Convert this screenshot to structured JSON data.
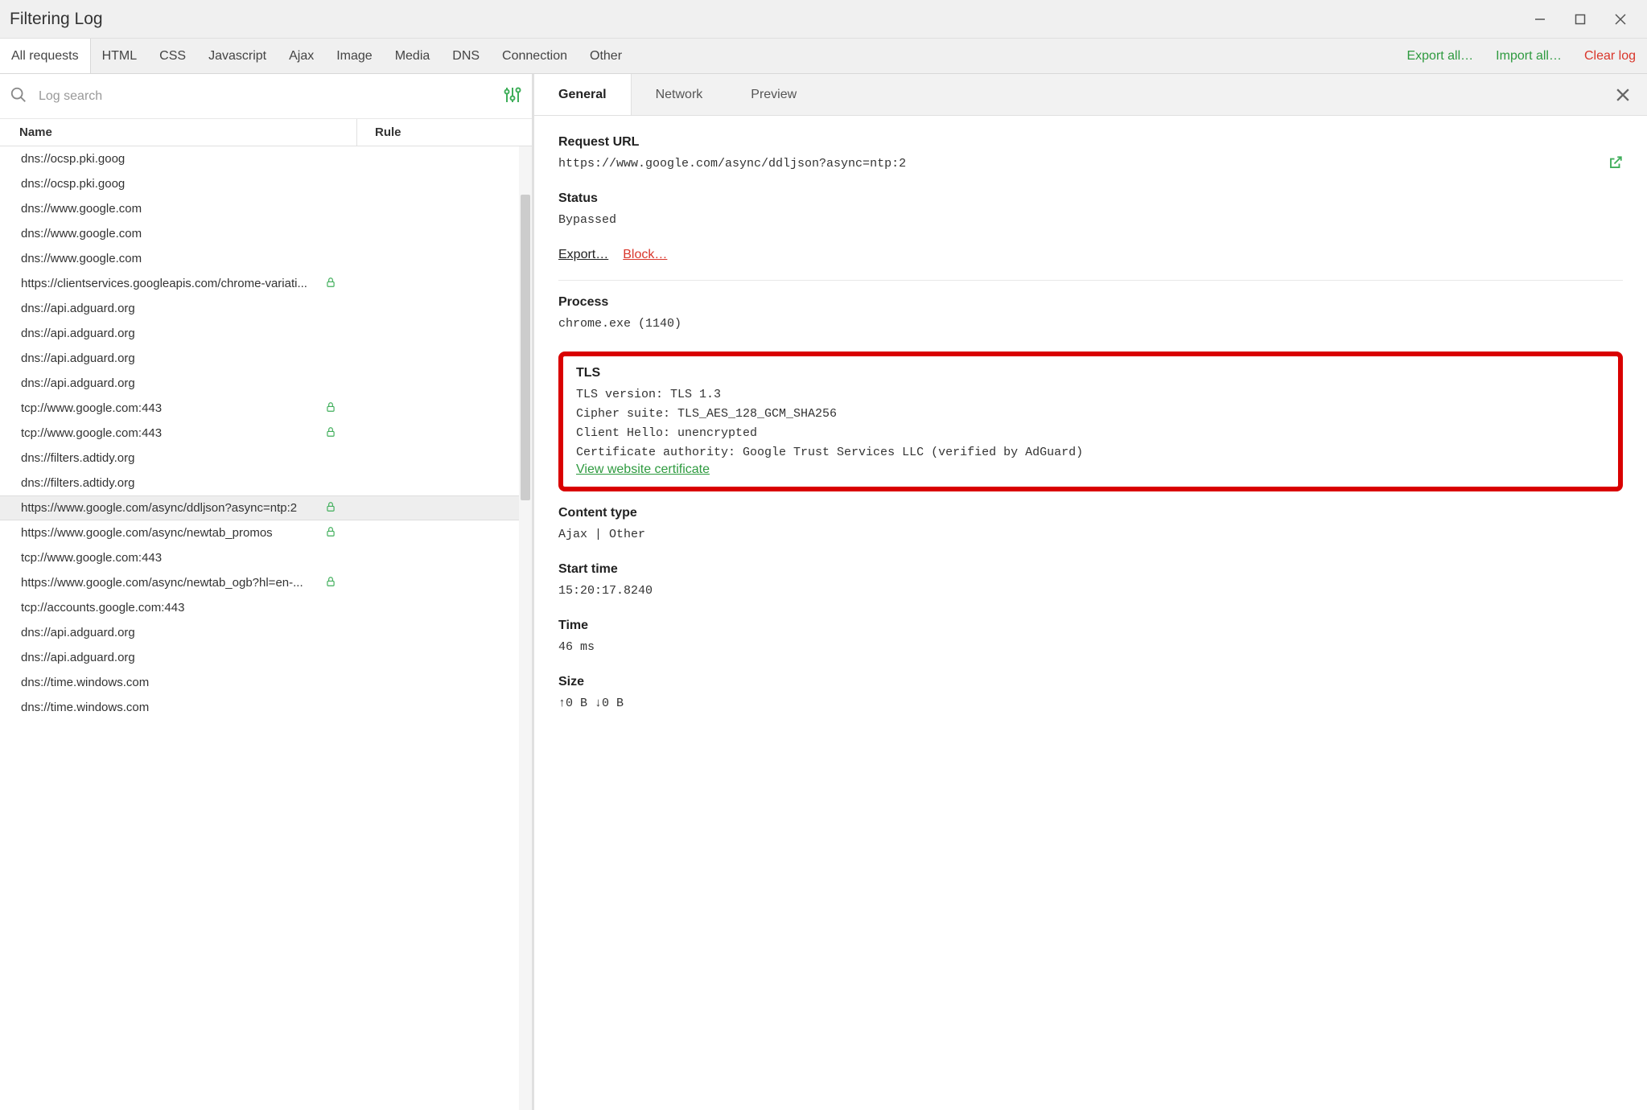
{
  "window": {
    "title": "Filtering Log"
  },
  "filterTabs": [
    {
      "label": "All requests",
      "active": true
    },
    {
      "label": "HTML"
    },
    {
      "label": "CSS"
    },
    {
      "label": "Javascript"
    },
    {
      "label": "Ajax"
    },
    {
      "label": "Image"
    },
    {
      "label": "Media"
    },
    {
      "label": "DNS"
    },
    {
      "label": "Connection"
    },
    {
      "label": "Other"
    }
  ],
  "actions": {
    "export_all": "Export all…",
    "import_all": "Import all…",
    "clear_log": "Clear log"
  },
  "search": {
    "placeholder": "Log search"
  },
  "columns": {
    "name": "Name",
    "rule": "Rule"
  },
  "rows": [
    {
      "url": "dns://ocsp.pki.goog"
    },
    {
      "url": "dns://ocsp.pki.goog"
    },
    {
      "url": "dns://www.google.com"
    },
    {
      "url": "dns://www.google.com"
    },
    {
      "url": "dns://www.google.com"
    },
    {
      "url": "https://clientservices.googleapis.com/chrome-variati...",
      "lock": true
    },
    {
      "url": "dns://api.adguard.org"
    },
    {
      "url": "dns://api.adguard.org"
    },
    {
      "url": "dns://api.adguard.org"
    },
    {
      "url": "dns://api.adguard.org"
    },
    {
      "url": "tcp://www.google.com:443",
      "lock": true
    },
    {
      "url": "tcp://www.google.com:443",
      "lock": true
    },
    {
      "url": "dns://filters.adtidy.org"
    },
    {
      "url": "dns://filters.adtidy.org"
    },
    {
      "url": "https://www.google.com/async/ddljson?async=ntp:2",
      "lock": true,
      "selected": true
    },
    {
      "url": "https://www.google.com/async/newtab_promos",
      "lock": true
    },
    {
      "url": "tcp://www.google.com:443"
    },
    {
      "url": "https://www.google.com/async/newtab_ogb?hl=en-...",
      "lock": true
    },
    {
      "url": "tcp://accounts.google.com:443"
    },
    {
      "url": "dns://api.adguard.org"
    },
    {
      "url": "dns://api.adguard.org"
    },
    {
      "url": "dns://time.windows.com"
    },
    {
      "url": "dns://time.windows.com"
    }
  ],
  "detailTabs": [
    {
      "label": "General",
      "active": true
    },
    {
      "label": "Network"
    },
    {
      "label": "Preview"
    }
  ],
  "detail": {
    "request_url_label": "Request URL",
    "request_url": "https://www.google.com/async/ddljson?async=ntp:2",
    "status_label": "Status",
    "status": "Bypassed",
    "export": "Export…",
    "block": "Block…",
    "process_label": "Process",
    "process": "chrome.exe (1140)",
    "tls_label": "TLS",
    "tls_version": "TLS version: TLS 1.3",
    "cipher_suite": "Cipher suite: TLS_AES_128_GCM_SHA256",
    "client_hello": "Client Hello: unencrypted",
    "cert_auth": "Certificate authority: Google Trust Services LLC (verified by AdGuard)",
    "view_cert": "View website certificate",
    "content_type_label": "Content type",
    "content_type": "Ajax | Other",
    "start_time_label": "Start time",
    "start_time": "15:20:17.8240",
    "time_label": "Time",
    "time": "46 ms",
    "size_label": "Size",
    "size": "↑0 B ↓0 B"
  }
}
